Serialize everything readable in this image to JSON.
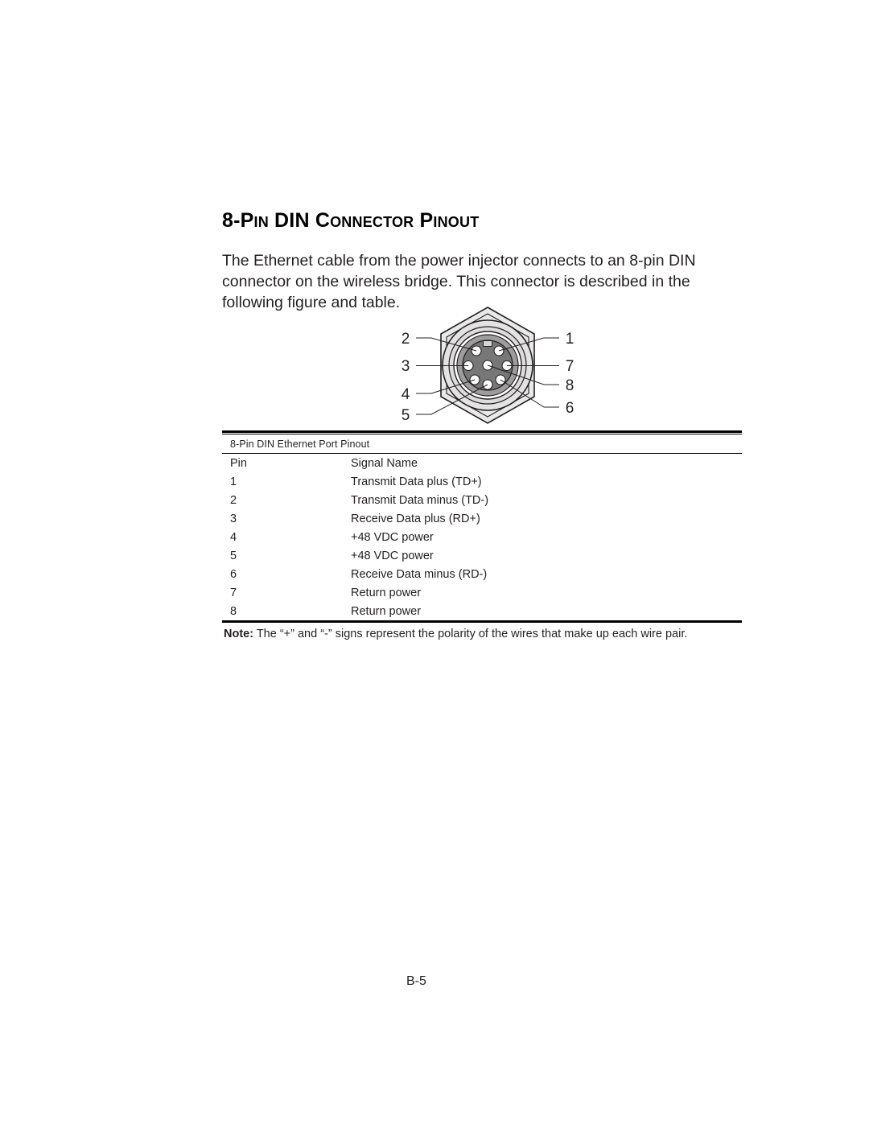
{
  "heading": "8-Pin DIN Connector Pinout",
  "intro": "The Ethernet cable from the power injector connects to an 8-pin DIN connector on the wireless bridge. This connector is described in the following figure and table.",
  "figure": {
    "name": "8-pin DIN connector face view",
    "labels_left": [
      "2",
      "3",
      "4",
      "5"
    ],
    "labels_right": [
      "1",
      "7",
      "8",
      "6"
    ],
    "colors": {
      "hex_body": "#e8e8e8",
      "outer_ring": "#d8d8d8",
      "inner_ring": "#9a9a9a",
      "face": "#7d7d7d",
      "pin": "#ffffff",
      "outline": "#231f20"
    }
  },
  "table": {
    "caption": "8-Pin DIN Ethernet Port Pinout",
    "columns": [
      "Pin",
      "Signal Name"
    ],
    "rows": [
      {
        "pin": "1",
        "signal": "Transmit Data plus (TD+)"
      },
      {
        "pin": "2",
        "signal": "Transmit Data minus (TD-)"
      },
      {
        "pin": "3",
        "signal": "Receive Data plus (RD+)"
      },
      {
        "pin": "4",
        "signal": "+48 VDC power"
      },
      {
        "pin": "5",
        "signal": "+48 VDC power"
      },
      {
        "pin": "6",
        "signal": "Receive Data minus (RD-)"
      },
      {
        "pin": "7",
        "signal": "Return power"
      },
      {
        "pin": "8",
        "signal": "Return power"
      }
    ],
    "note_label": "Note:",
    "note_text": " The “+” and “-” signs represent the polarity of the wires that make up each wire pair."
  },
  "footer": {
    "page_number": "B-5"
  }
}
